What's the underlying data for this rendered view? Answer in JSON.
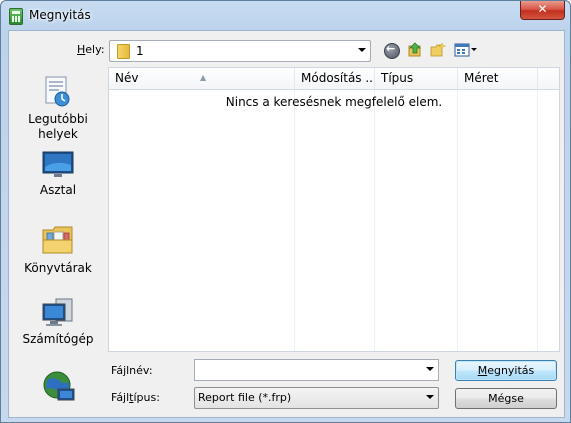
{
  "window": {
    "title": "Megnyitás",
    "close_label": "✕"
  },
  "location": {
    "label_prefix": "",
    "label_accel": "H",
    "label_rest": "ely:",
    "value": "1"
  },
  "toolbar": {
    "icons": [
      "back-icon",
      "up-folder-icon",
      "new-folder-icon",
      "views-menu-icon"
    ]
  },
  "nav": {
    "items": [
      {
        "id": "recent",
        "label": "Legutóbbi helyek",
        "icon": "recent-places-icon"
      },
      {
        "id": "desktop",
        "label": "Asztal",
        "icon": "desktop-icon"
      },
      {
        "id": "libraries",
        "label": "Könyvtárak",
        "icon": "libraries-icon"
      },
      {
        "id": "computer",
        "label": "Számítógép",
        "icon": "computer-icon"
      },
      {
        "id": "network",
        "label": "",
        "icon": "network-icon"
      }
    ]
  },
  "file_list": {
    "columns": [
      "Név",
      "Módosítás ...",
      "Típus",
      "Méret"
    ],
    "empty_message": "Nincs a keresésnek megfelelő elem."
  },
  "filename": {
    "label_prefix": "Fá",
    "label_accel": "j",
    "label_rest": "lnév:",
    "value": ""
  },
  "filetype": {
    "label_prefix": "Fájl",
    "label_accel": "t",
    "label_rest": "ípus:",
    "value": "Report file (*.frp)"
  },
  "buttons": {
    "open_accel": "M",
    "open_rest": "egnyitás",
    "cancel": "Mégse"
  },
  "colors": {
    "accent": "#3c7fb1",
    "close_red": "#c0301f"
  }
}
